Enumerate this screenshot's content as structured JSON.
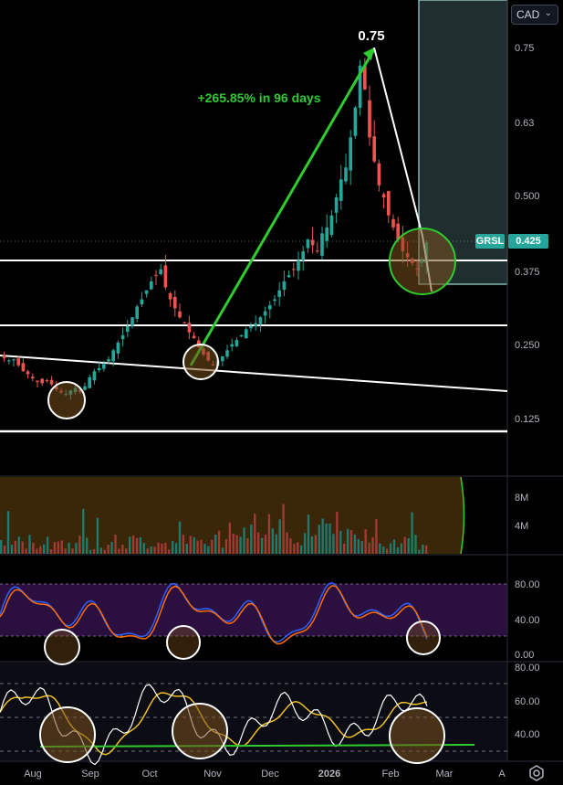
{
  "header": {
    "currency": "CAD"
  },
  "ticker": {
    "symbol": "GRSL",
    "last_price": "0.425"
  },
  "annotations": {
    "peak_label": "0.75",
    "gain_label": "+265.85% in 96 days"
  },
  "colors": {
    "up": "#26a69a",
    "down": "#ef5350",
    "trendline": "#ffffff",
    "arrow": "#2ecc2e",
    "macd_fast": "#2962ff",
    "macd_slow": "#ff6d00",
    "osc_panel_bg": "#2a0f3f",
    "volume_panel_bg": "#3a2608",
    "rsi_ma": "#f0c020"
  },
  "price_axis": {
    "ticks": [
      "0.75",
      "0.63",
      "0.500",
      "0.375",
      "0.250",
      "0.125"
    ]
  },
  "volume_axis": {
    "ticks": [
      "8M",
      "4M"
    ]
  },
  "stoch_axis": {
    "ticks": [
      "80.00",
      "40.00",
      "0.00"
    ]
  },
  "rsi_axis": {
    "ticks": [
      "80.00",
      "60.00",
      "40.00"
    ]
  },
  "time_axis": {
    "labels": [
      "Aug",
      "Sep",
      "Oct",
      "Nov",
      "Dec",
      "2026",
      "Feb",
      "Mar",
      "A"
    ]
  },
  "chart_data": {
    "type": "candlestick",
    "price_ticks": [
      0.75,
      0.63,
      0.5,
      0.375,
      0.25,
      0.125
    ],
    "y_range": [
      0.05,
      0.8
    ],
    "months": [
      "Aug",
      "Sep",
      "Oct",
      "Nov",
      "Dec",
      "2026",
      "Feb",
      "Mar"
    ],
    "closes": [
      0.232,
      0.228,
      0.23,
      0.22,
      0.21,
      0.205,
      0.198,
      0.192,
      0.19,
      0.195,
      0.188,
      0.18,
      0.175,
      0.172,
      0.178,
      0.182,
      0.176,
      0.185,
      0.2,
      0.21,
      0.215,
      0.222,
      0.23,
      0.245,
      0.258,
      0.27,
      0.285,
      0.3,
      0.318,
      0.33,
      0.345,
      0.36,
      0.37,
      0.38,
      0.35,
      0.33,
      0.315,
      0.3,
      0.29,
      0.275,
      0.265,
      0.25,
      0.238,
      0.228,
      0.22,
      0.228,
      0.235,
      0.245,
      0.255,
      0.262,
      0.27,
      0.28,
      0.285,
      0.29,
      0.3,
      0.31,
      0.32,
      0.33,
      0.345,
      0.36,
      0.37,
      0.38,
      0.395,
      0.41,
      0.43,
      0.42,
      0.41,
      0.44,
      0.45,
      0.47,
      0.5,
      0.53,
      0.55,
      0.6,
      0.65,
      0.72,
      0.68,
      0.6,
      0.56,
      0.52,
      0.5,
      0.47,
      0.45,
      0.43,
      0.41,
      0.4,
      0.39,
      0.38,
      0.395,
      0.425
    ],
    "gain_pct": 265.85,
    "gain_days": 96,
    "peak": 0.75
  }
}
